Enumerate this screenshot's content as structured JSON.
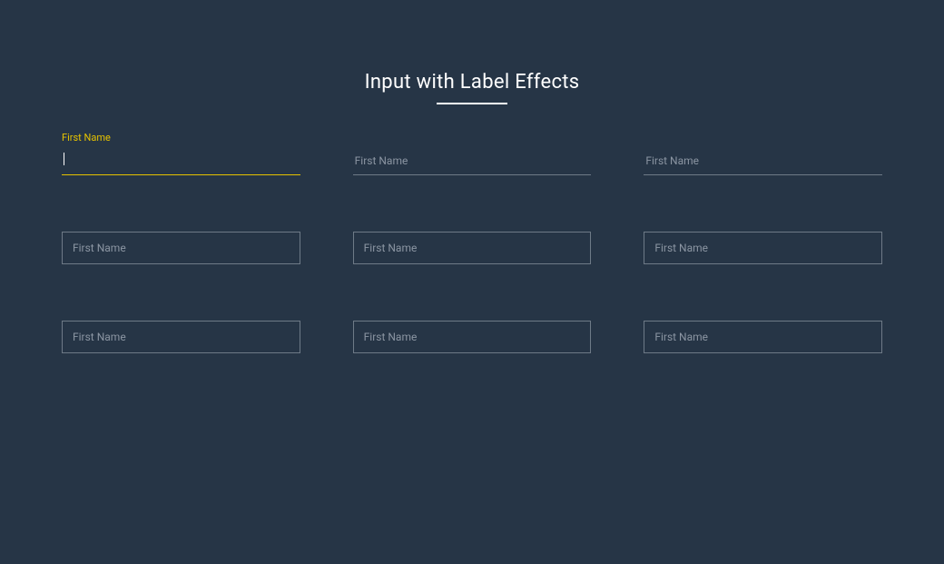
{
  "title": "Input with Label Effects",
  "fields": {
    "row1": [
      {
        "label": "First Name",
        "value": "",
        "focused": true
      },
      {
        "label": "First Name",
        "value": "",
        "focused": false
      },
      {
        "label": "First Name",
        "value": "",
        "focused": false
      }
    ],
    "row2": [
      {
        "label": "First Name",
        "value": ""
      },
      {
        "label": "First Name",
        "value": ""
      },
      {
        "label": "First Name",
        "value": ""
      }
    ],
    "row3": [
      {
        "label": "First Name",
        "value": ""
      },
      {
        "label": "First Name",
        "value": ""
      },
      {
        "label": "First Name",
        "value": ""
      }
    ]
  }
}
